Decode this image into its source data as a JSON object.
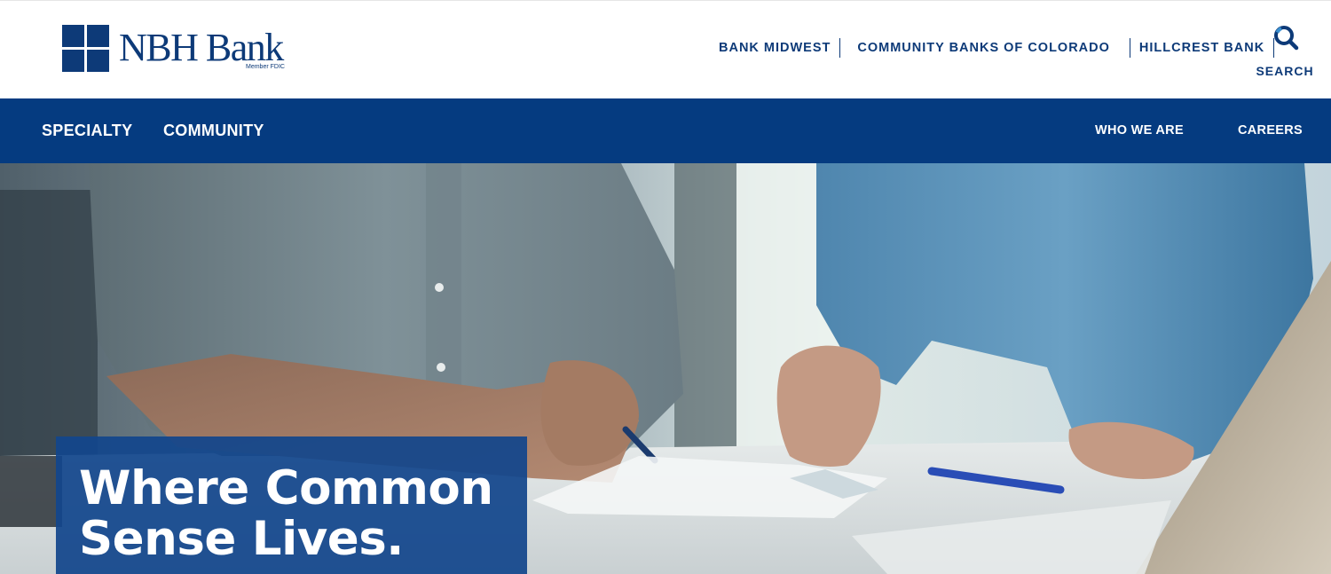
{
  "brand": {
    "name": "NBH Bank",
    "tagline": "Member FDIC",
    "color": "#0d3a78"
  },
  "affiliates": [
    {
      "label": "BANK MIDWEST"
    },
    {
      "label": "COMMUNITY BANKS OF COLORADO"
    },
    {
      "label": "HILLCREST BANK"
    }
  ],
  "search": {
    "label": "SEARCH",
    "icon": "search-icon",
    "icon_accent": "#3a8fd0"
  },
  "nav": {
    "background": "#053b80",
    "primary": [
      {
        "label": "SPECIALTY"
      },
      {
        "label": "COMMUNITY"
      }
    ],
    "secondary": [
      {
        "label": "WHO WE ARE"
      },
      {
        "label": "CAREERS"
      }
    ]
  },
  "hero": {
    "headline_line1": "Where Common",
    "headline_line2": "Sense Lives.",
    "caption_color": "#12468c"
  }
}
